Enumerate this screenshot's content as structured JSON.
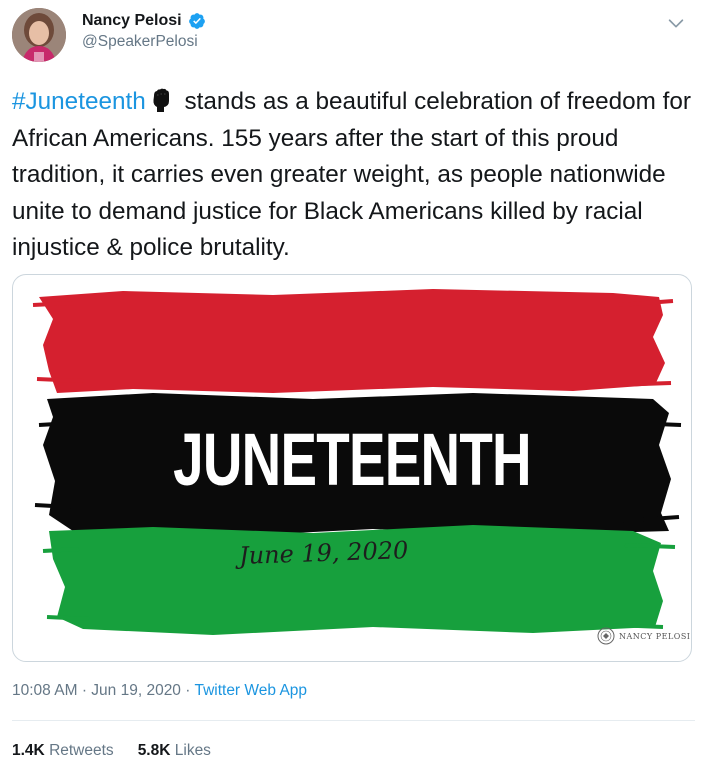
{
  "author": {
    "display_name": "Nancy Pelosi",
    "handle": "@SpeakerPelosi",
    "verified": true
  },
  "tweet": {
    "hashtag": "#Juneteenth",
    "emoji": "raised-fist",
    "body": " stands as a beautiful celebration of freedom for African Americans. 155 years after the start of this proud tradition, it carries even greater weight, as people nationwide unite to demand justice for Black Americans killed by racial injustice & police brutality."
  },
  "media": {
    "title": "JUNETEENTH",
    "date": "June 19, 2020",
    "watermark": "NANCY PELOSI",
    "colors": {
      "red": "#d5202f",
      "black": "#0a0a0a",
      "green": "#17a03d"
    }
  },
  "meta": {
    "time": "10:08 AM",
    "separator": "·",
    "date": "Jun 19, 2020",
    "source": "Twitter Web App"
  },
  "stats": {
    "retweets_count": "1.4K",
    "retweets_label": "Retweets",
    "likes_count": "5.8K",
    "likes_label": "Likes"
  },
  "colors": {
    "link": "#1b95e0",
    "muted": "#657786",
    "text": "#14171a"
  }
}
